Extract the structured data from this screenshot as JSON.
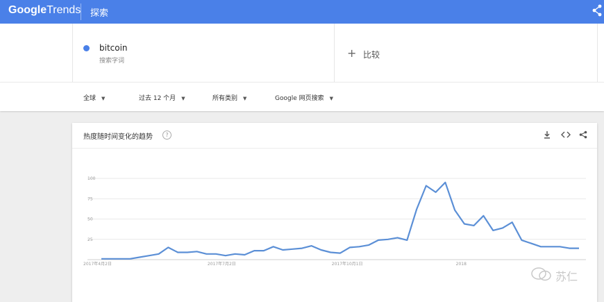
{
  "header": {
    "logo_google": "Google",
    "logo_trends": "Trends",
    "page_label": "探索",
    "share_icon": "share-icon"
  },
  "terms": [
    {
      "name": "bitcoin",
      "type": "搜索字词",
      "color": "#4a80e8"
    }
  ],
  "compare": {
    "plus": "+",
    "label": "比较"
  },
  "filters": [
    {
      "label": "全球"
    },
    {
      "label": "过去 12 个月"
    },
    {
      "label": "所有类别"
    },
    {
      "label": "Google 网页搜索"
    }
  ],
  "chart_card": {
    "title": "热度随时间变化的趋势",
    "help_icon": "help-icon",
    "icons": [
      "download-icon",
      "embed-icon",
      "share-icon"
    ]
  },
  "chart_data": {
    "type": "line",
    "title": "热度随时间变化的趋势",
    "xlabel": "",
    "ylabel": "",
    "ylim": [
      0,
      100
    ],
    "yticks": [
      "100",
      "75",
      "50",
      "25"
    ],
    "xticks": [
      {
        "index": 0,
        "label": "2017年4月2日"
      },
      {
        "index": 13,
        "label": "2017年7月2日"
      },
      {
        "index": 26,
        "label": "2017年10月1日"
      },
      {
        "index": 39,
        "label": "2018"
      }
    ],
    "grid": true,
    "series": [
      {
        "name": "bitcoin",
        "color": "#5b8fd6",
        "values": [
          1,
          1,
          1,
          1,
          3,
          5,
          7,
          15,
          9,
          9,
          10,
          7,
          7,
          5,
          7,
          6,
          11,
          11,
          16,
          12,
          13,
          14,
          17,
          12,
          9,
          8,
          15,
          16,
          18,
          24,
          25,
          27,
          24,
          62,
          91,
          83,
          95,
          61,
          44,
          42,
          54,
          36,
          39,
          46,
          24,
          20,
          16,
          16,
          16,
          14,
          14
        ]
      }
    ]
  },
  "watermark": {
    "text": "苏仁",
    "icon": "wechat-icon"
  }
}
